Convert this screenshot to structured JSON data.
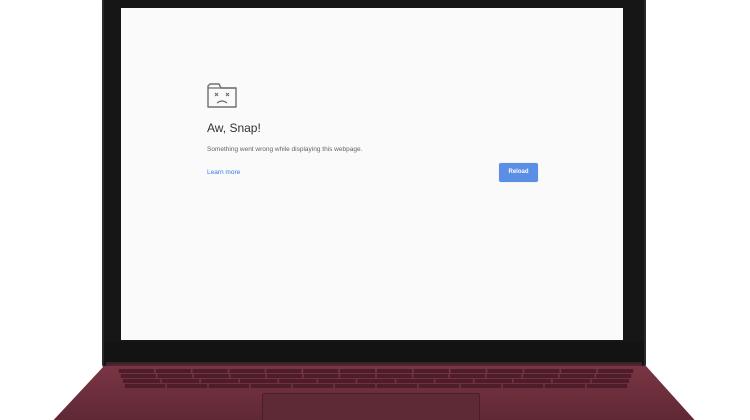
{
  "error_page": {
    "title": "Aw, Snap!",
    "message": "Something went wrong while displaying this webpage.",
    "learn_more": "Learn more",
    "reload_label": "Reload",
    "icon": "sad-tab-icon"
  },
  "colors": {
    "screen_bg": "#fafafa",
    "link": "#3b78e7",
    "button_bg": "#5b8fe6",
    "laptop_body": "#6b2e3c"
  }
}
